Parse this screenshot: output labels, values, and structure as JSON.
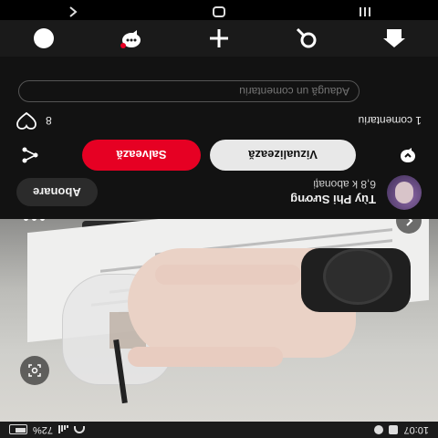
{
  "status_bar": {
    "time": "10:07",
    "battery": "72%"
  },
  "profile": {
    "name": "Tùy Phi Sương",
    "followers": "6,8 k abonați",
    "subscribe_label": "Abonare"
  },
  "actions": {
    "view_label": "Vizualizează",
    "save_label": "Salvează"
  },
  "comments": {
    "count_label": "1 comentariu",
    "likes": "8",
    "input_placeholder": "Adaugă un comentariu"
  },
  "icons": {
    "back": "chevron-left-icon",
    "more": "more-dots-icon",
    "lens": "visual-search-icon",
    "share": "share-icon",
    "message": "message-icon",
    "heart": "heart-icon",
    "nav_home": "home-icon",
    "nav_search": "search-icon",
    "nav_create": "plus-icon",
    "nav_messages": "chat-icon",
    "nav_profile": "profile-icon"
  },
  "colors": {
    "save": "#e60023",
    "background": "#121212"
  }
}
